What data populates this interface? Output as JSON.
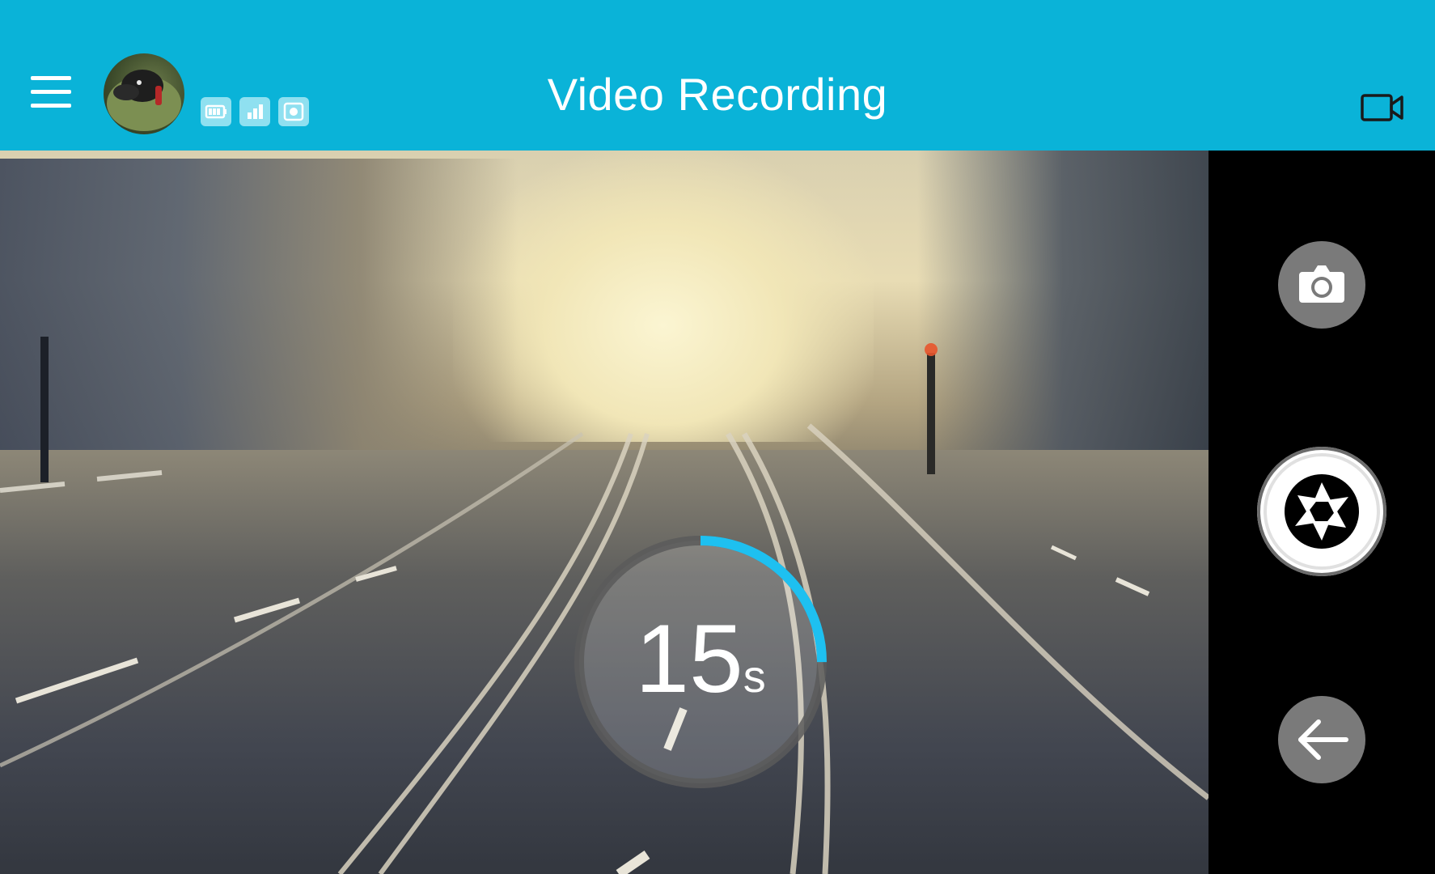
{
  "header": {
    "title": "Video Recording",
    "background_color": "#0ab3d8",
    "menu_icon": "hamburger-menu-icon",
    "avatar": "user-avatar",
    "status_icons": [
      "battery-icon",
      "signal-icon",
      "storage-icon"
    ],
    "mode_icon": "video-camera-icon"
  },
  "timer": {
    "value": "15",
    "unit": "s",
    "progress": 0.25,
    "progress_color": "#1ec0f0"
  },
  "controls": {
    "photo_button_icon": "camera-icon",
    "shutter_button_icon": "aperture-icon",
    "back_button_icon": "arrow-left-icon"
  }
}
